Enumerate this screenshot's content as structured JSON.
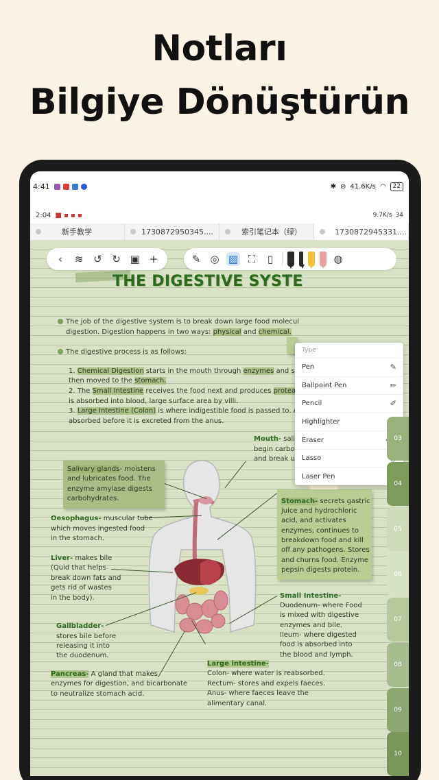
{
  "headline": {
    "line1": "Notları",
    "line2": "Bilgiye Dönüştürün"
  },
  "status_bar_outer": {
    "time": "4:41",
    "network": "41.6K/s",
    "battery": "22"
  },
  "status_bar_inner": {
    "time": "2:04",
    "network": "9.7K/s",
    "battery": "34"
  },
  "tabs": [
    {
      "label": "新手教学"
    },
    {
      "label": "1730872950345...."
    },
    {
      "label": "索引笔记本（绿）"
    },
    {
      "label": "1730872945331...."
    }
  ],
  "toolbar": {
    "left_icons": [
      "back-icon",
      "layers-icon",
      "undo-icon",
      "redo-icon",
      "page-icon",
      "add-icon"
    ],
    "right_icons": [
      "pen-icon",
      "lasso-icon",
      "image-icon",
      "crop-icon",
      "book-icon"
    ],
    "pen_colors": [
      "#2b2b2b",
      "#2b2b2b",
      "#f2c230",
      "#e8a0a0"
    ]
  },
  "type_menu": {
    "header": "Type",
    "items": [
      {
        "label": "Pen",
        "icon": "pen-icon"
      },
      {
        "label": "Ballpoint Pen",
        "icon": "ballpoint-icon"
      },
      {
        "label": "Pencil",
        "icon": "pencil-icon"
      },
      {
        "label": "Highlighter",
        "icon": "highlighter-icon"
      },
      {
        "label": "Eraser",
        "icon": "eraser-icon"
      },
      {
        "label": "Lasso",
        "icon": "lasso-icon"
      },
      {
        "label": "Laser Pen",
        "icon": "laser-icon"
      }
    ]
  },
  "note": {
    "title": "THE DIGESTIVE SYSTE",
    "intro": {
      "l1_a": "The job of the digestive system is to break down large food molecul",
      "l2_a": "digestion. Digestion happens in two ways: ",
      "l2_b": "physical",
      "l2_c": " and ",
      "l2_d": "chemical."
    },
    "process": {
      "head": "The digestive process is as follows:",
      "s1_a": "1. ",
      "s1_b": "Chemical Digestion",
      "s1_c": " starts in the mouth through ",
      "s1_d": "enzymes",
      "s1_e": " and sal",
      "s1b_a": "then moved to the ",
      "s1b_b": "stomach.",
      "s2_a": "2. The ",
      "s2_b": "Small Intestine",
      "s2_c": " receives the food next and produces ",
      "s2_d": "proteas",
      "s2b": "is absorbed into blood, large surface area by villi.",
      "s3_a": "3. ",
      "s3_b": "Large Intestine (Colon)",
      "s3_c": " is where indigestible food is passed to. Ar",
      "s3b": "absorbed before it is excreted from the anus."
    },
    "labels": {
      "mouth_head": "Mouth-",
      "mouth_1": " salivary enzymes",
      "mouth_2": "begin carbohydrate digestion",
      "mouth_3": "and break up food particles.",
      "saliv_head": "Salivary glands",
      "saliv_1": "- moistens",
      "saliv_2": "and lubricates food. The",
      "saliv_3": "enzyme amylase digests",
      "saliv_4": "carbohydrates.",
      "oes_head": "Oesophagus-",
      "oes_1": " muscular tube",
      "oes_2": "which moves ingested food",
      "oes_3": "in the stomach.",
      "stom_head": "Stomach-",
      "stom_1": " secrets gastric",
      "stom_2": "juice and hydrochloric",
      "stom_3": "acid, and activates",
      "stom_4": "enzymes, continues to",
      "stom_5": "breakdown food and kill",
      "stom_6": "off any pathogens. Stores",
      "stom_7": "and churns food. Enzyme",
      "stom_8": "pepsin digests protein.",
      "liver_head": "Liver-",
      "liver_1": " makes bile",
      "liver_2": "(Quid that helps",
      "liver_3": "break down fats and",
      "liver_4": "gets rid of wastes",
      "liver_5": "in the body).",
      "si_head": "Small Intestine-",
      "si_1": "Duodenum- where Food",
      "si_2": "is mixed with digestive",
      "si_3": "enzymes and bile.",
      "si_4": "Ileum- where digested",
      "si_5": "food is absorbed into",
      "si_6": "the blood and lymph.",
      "gb_head": "Gallbladder-",
      "gb_1": "stores bile before",
      "gb_2": "releasing it into",
      "gb_3": "the duodenum.",
      "li_head": "Large intestine-",
      "li_1": "Colon- where water is reabsorbed.",
      "li_2": "Rectum- stores and expels faeces.",
      "li_3": "Anus- where faeces leave the",
      "li_4": "alimentary canal.",
      "panc_head": "Pancreas-",
      "panc_1": " A gland that makes",
      "panc_2": "enzymes for digestion, and bicarbonate",
      "panc_3": "to neutralize stomach acid."
    }
  },
  "page_tabs": [
    "03",
    "04",
    "05",
    "06",
    "07",
    "08",
    "09",
    "10"
  ],
  "colors": {
    "note_bg": "#d9e2c6",
    "accent_green": "#2d6a1f",
    "tab_dark": "#7e9a5c",
    "tab_mid": "#a3b98a",
    "tab_light": "#cfdcbc"
  }
}
